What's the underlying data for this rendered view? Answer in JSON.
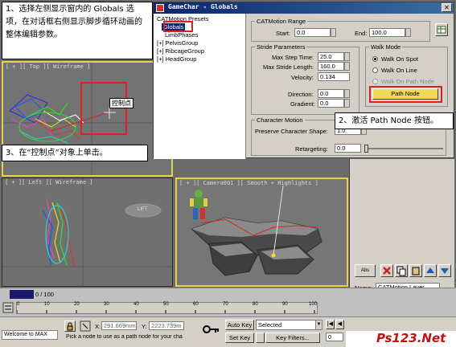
{
  "dialog": {
    "title": "GameChar - Globals",
    "tree": {
      "root": "CATMotion Presets",
      "selected": "Globals",
      "items": [
        "LimbPhases",
        "[+] PelvisGroup",
        "[+] RibcageGroup",
        "[+] HeadGroup"
      ]
    },
    "range": {
      "title": "CATMotion Range",
      "start_label": "Start:",
      "start_value": "0.0",
      "end_label": "End:",
      "end_value": "100.0"
    },
    "stride": {
      "title": "Stride Parameters",
      "max_step_time_label": "Max Step Time:",
      "max_step_time_value": "25.0",
      "max_stride_length_label": "Max Stride Length:",
      "max_stride_length_value": "160.0",
      "velocity_label": "Velocity:",
      "velocity_value": "0.134",
      "direction_label": "Direction:",
      "direction_value": "0.0",
      "gradient_label": "Gradient:",
      "gradient_value": "0.0"
    },
    "walk_mode": {
      "title": "Walk Mode",
      "options": [
        "Walk On Spot",
        "Walk On Line",
        "Walk On Path Node"
      ],
      "selected_index": 0,
      "path_node_button": "Path Node"
    },
    "character_motion": {
      "title": "Character Motion",
      "preserve_label": "Preserve Character Shape:",
      "preserve_value": "1.0",
      "retargeting_label": "Retargeting:",
      "retargeting_value": "0.0"
    }
  },
  "callouts": {
    "step1": "1、选择左侧显示窗内的 Globals 选项，在对话框右侧显示脚步循环动画的整体编辑参数。",
    "step2": "2、激活 Path Node 按钮。",
    "step3": "3、在“控制点”对象上单击。"
  },
  "viewports": {
    "top_label": "[ + ][ Top ][ Wireframe ]",
    "top_object_label": "控制点",
    "left_label": "[ + ][ Left ][ Wireframe ]",
    "left_object_label": "LIFT",
    "camera_label": "[ + ][ Camera001 ][ Smooth + Highlights ]"
  },
  "command_panel": {
    "name_label": "Name:",
    "name_value": "CATMotion Layer"
  },
  "timeline": {
    "frame_counter": "0 / 100",
    "ticks": [
      "0",
      "10",
      "20",
      "30",
      "40",
      "50",
      "60",
      "70",
      "80",
      "90",
      "100"
    ]
  },
  "status": {
    "welcome": "Welcome to MAX",
    "prompt": "Pick a node to use as a path node for your cha",
    "x_label": "X:",
    "x_value": "291.669mm",
    "y_label": "Y:",
    "y_value": "2223.739m",
    "auto_key": "Auto Key",
    "set_key": "Set Key",
    "selected_dropdown": "Selected",
    "key_filters": "Key Filters...",
    "frame_value": "0"
  },
  "watermark": "Ps123.Net",
  "colors": {
    "accent_title": "#0a246a",
    "callout_red": "#e02020",
    "viewport_active": "#e8d050",
    "path_node_button": "#f0d858"
  }
}
